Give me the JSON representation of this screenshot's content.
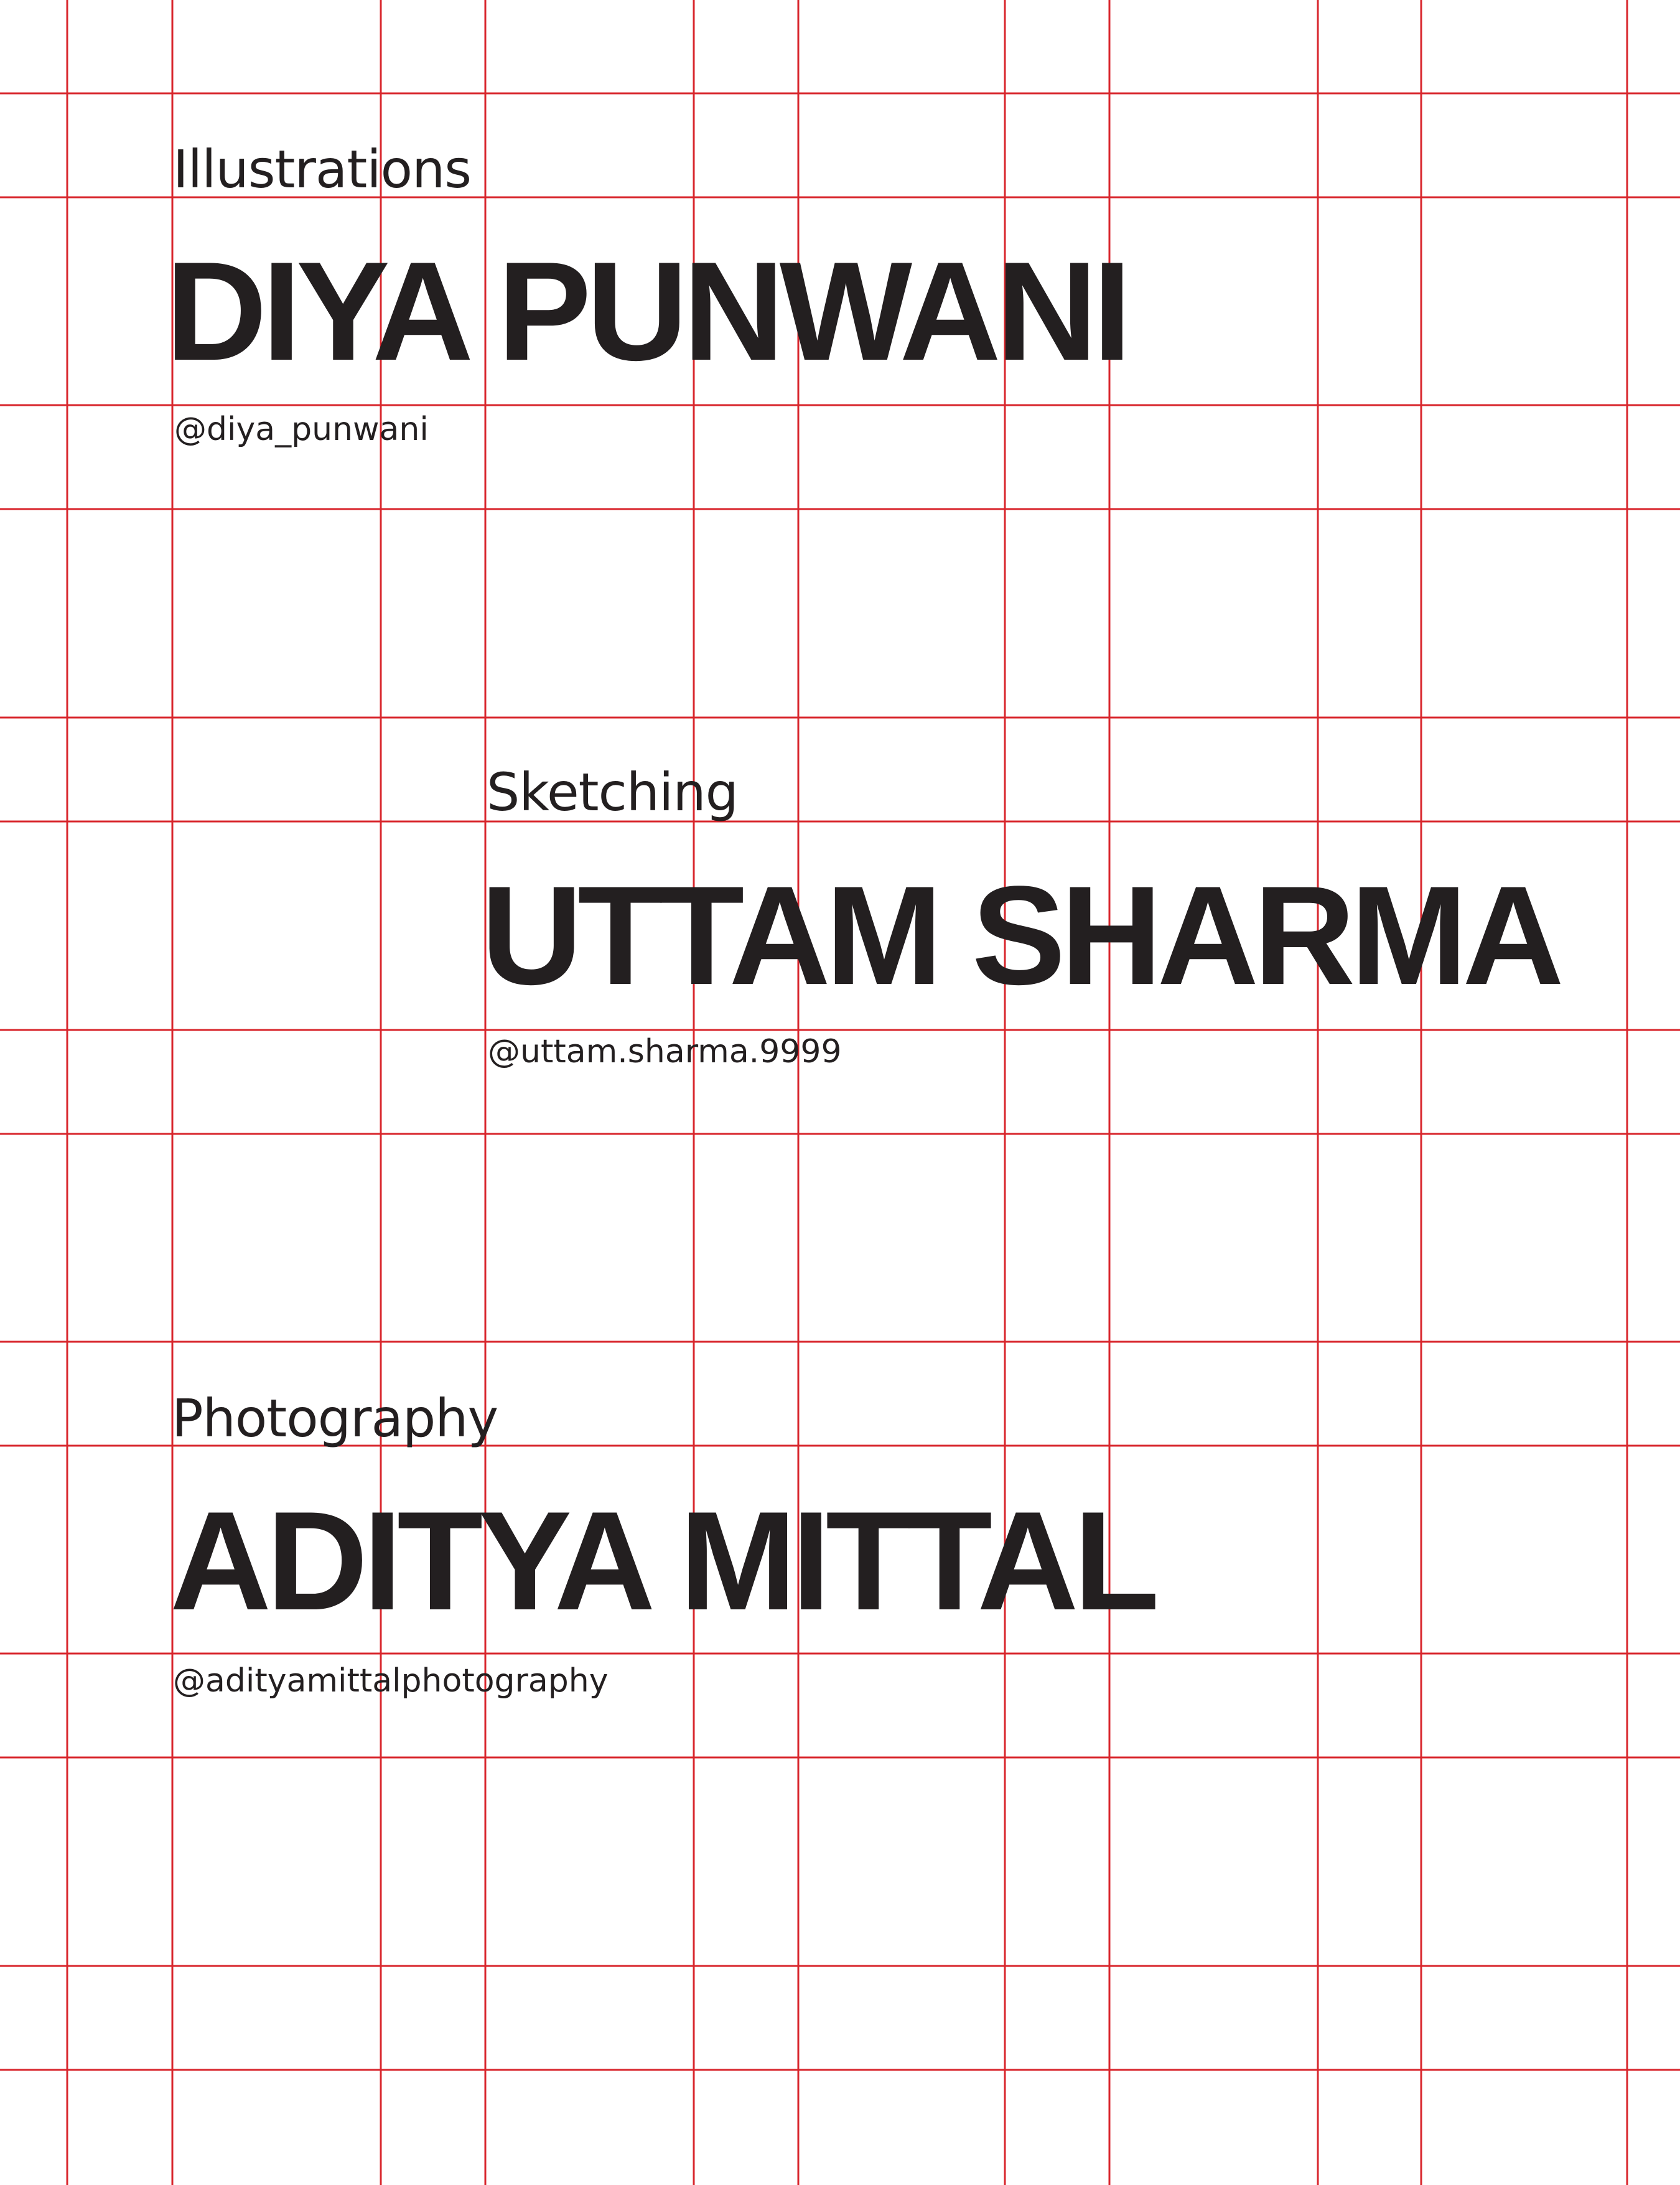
{
  "grid": {
    "color": "#d8262c"
  },
  "sections": [
    {
      "category": "Illustrations",
      "name": "DIYA PUNWANI",
      "handle": "@diya_punwani"
    },
    {
      "category": "Sketching",
      "name": "UTTAM SHARMA",
      "handle": "@uttam.sharma.9999"
    },
    {
      "category": "Photography",
      "name": "ADITYA MITTAL",
      "handle": "@adityamittalphotography"
    }
  ],
  "text_color": "#231f20"
}
